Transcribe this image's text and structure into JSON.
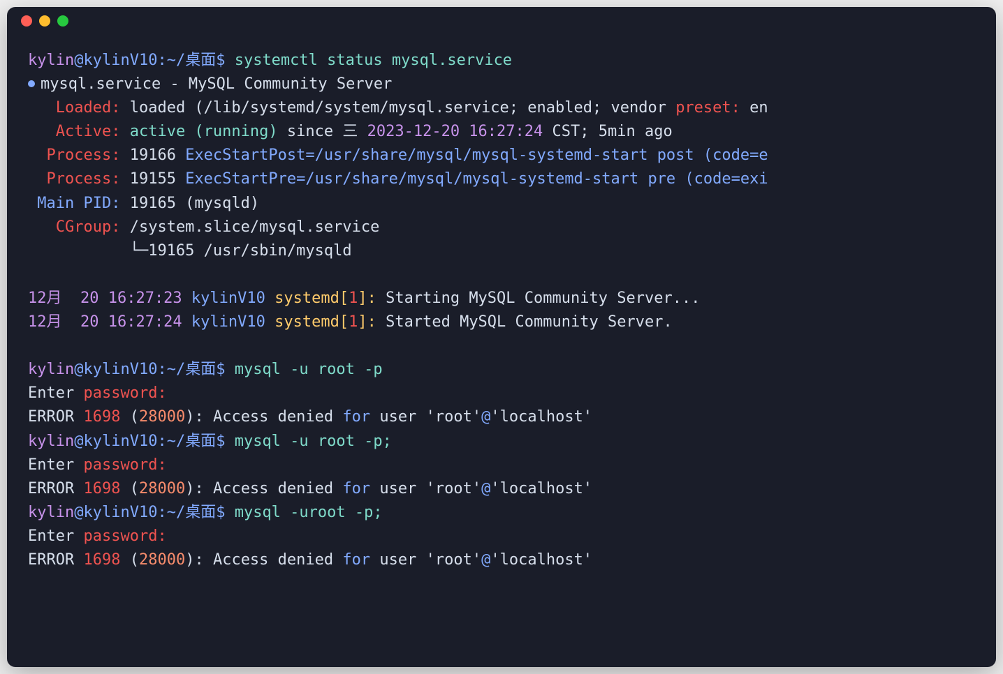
{
  "prompt": {
    "user": "kylin",
    "at": "@",
    "host": "kylinV10",
    "colon": ":",
    "path": "~/桌面",
    "dollar": "$"
  },
  "cmd1": "systemctl status mysql.service",
  "status": {
    "service_line": "mysql.service - MySQL Community Server",
    "loaded_label": "Loaded:",
    "loaded_value": "loaded (/lib/systemd/system/mysql.service; enabled; vendor ",
    "loaded_preset": "preset:",
    "loaded_en": " en",
    "active_label": "Active:",
    "active_state": "active (running)",
    "active_since": " since 三 ",
    "active_date": "2023-12-20 16:27:24",
    "active_cst": " CST; 5min ago",
    "process1_label": "Process:",
    "process1_pid": " 19166 ",
    "process1_exec": "ExecStartPost=/usr/share/mysql/mysql-systemd-start post (code=e",
    "process2_label": "Process:",
    "process2_pid": " 19155 ",
    "process2_exec": "ExecStartPre=/usr/share/mysql/mysql-systemd-start pre (code=exi",
    "mainpid_label": "Main PID:",
    "mainpid_value": " 19165 (mysqld)",
    "cgroup_label": "CGroup:",
    "cgroup_value": " /system.slice/mysql.service",
    "cgroup_child": "└─19165 /usr/sbin/mysqld"
  },
  "logs": [
    {
      "date": "12月  20 16:27:23",
      "host": " kylinV10 ",
      "src": "systemd[",
      "num": "1",
      "close": "]: ",
      "msg": "Starting MySQL Community Server..."
    },
    {
      "date": "12月  20 16:27:24",
      "host": " kylinV10 ",
      "src": "systemd[",
      "num": "1",
      "close": "]: ",
      "msg": "Started MySQL Community Server."
    }
  ],
  "cmd2": "mysql -u root -p",
  "cmd3": "mysql -u root -p;",
  "cmd4": "mysql -uroot -p;",
  "enter_password": "Enter ",
  "password_word": "password:",
  "error": {
    "prefix": "ERROR ",
    "code": "1698",
    "paren_open": " (",
    "sqlstate": "28000",
    "paren_close": "): ",
    "access_denied": "Access denied ",
    "for_word": "for",
    "user_word": " user ",
    "user_val": "'root'",
    "at_sym": "@",
    "host_val": "'localhost'"
  }
}
